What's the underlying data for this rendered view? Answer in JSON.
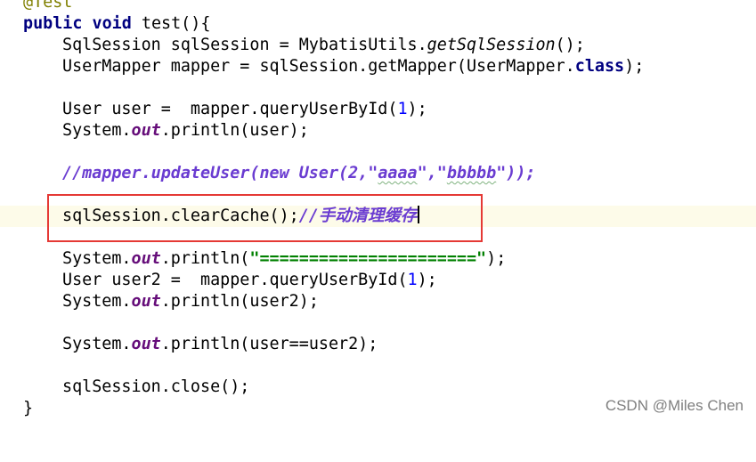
{
  "editor": {
    "annotation": "@Test",
    "signature": {
      "kw_public": "public",
      "kw_void": "void",
      "name": "test(){"
    },
    "session_line": {
      "prefix": "SqlSession sqlSession = MybatisUtils.",
      "method": "getSqlSession",
      "suffix": "();"
    },
    "mapper_line": {
      "prefix": "UserMapper mapper = sqlSession.getMapper(UserMapper.",
      "kw_class": "class",
      "suffix": ");"
    },
    "query_line": {
      "prefix": "User user =  mapper.queryUserById(",
      "arg": "1",
      "suffix": ");"
    },
    "print_user": {
      "prefix": "System.",
      "field": "out",
      "suffix": ".println(user);"
    },
    "commented_update": {
      "part1": "//mapper.updateUser(new User(2,\"",
      "squiggle1": "aaaa",
      "part2": "\",\"",
      "squiggle2": "bbbbb",
      "part3": "\"));"
    },
    "clear_cache": {
      "code": "sqlSession.clearCache();",
      "comment": "//手动清理缓存"
    },
    "print_separator": {
      "prefix": "System.",
      "field": "out",
      "mid": ".println(",
      "string": "\"======================\"",
      "suffix": ");"
    },
    "query_line2": {
      "prefix": "User user2 =  mapper.queryUserById(",
      "arg": "1",
      "suffix": ");"
    },
    "print_user2": {
      "prefix": "System.",
      "field": "out",
      "suffix": ".println(user2);"
    },
    "print_compare": {
      "prefix": "System.",
      "field": "out",
      "suffix": ".println(user==user2);"
    },
    "close_line": "sqlSession.close();",
    "closing_brace": "}"
  },
  "watermark": "CSDN @Miles Chen",
  "colors": {
    "keyword": "#000080",
    "static_field": "#660e7a",
    "number": "#0000ff",
    "string": "#008000",
    "comment": "#6a3cd1",
    "highlight_box": "#e53935",
    "current_line": "#fdfbe9"
  }
}
